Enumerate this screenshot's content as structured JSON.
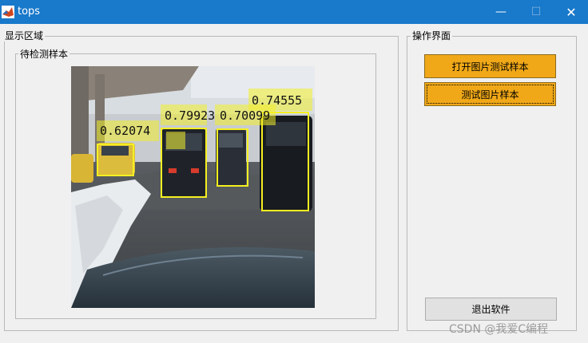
{
  "window": {
    "title": "tops"
  },
  "display_panel": {
    "title": "显示区域"
  },
  "sample_panel": {
    "title": "待检测样本"
  },
  "detections": [
    {
      "score": "0.62074"
    },
    {
      "score": "0.79923"
    },
    {
      "score": "0.70099"
    },
    {
      "score": "0.74555"
    }
  ],
  "operation_panel": {
    "title": "操作界面",
    "open_button": "打开图片测试样本",
    "test_button": "测试图片样本",
    "exit_button": "退出软件"
  },
  "watermark": "CSDN @我爱C编程",
  "colors": {
    "titlebar": "#1979ca",
    "button_orange": "#f0a818",
    "detection_box": "#f5f020"
  }
}
